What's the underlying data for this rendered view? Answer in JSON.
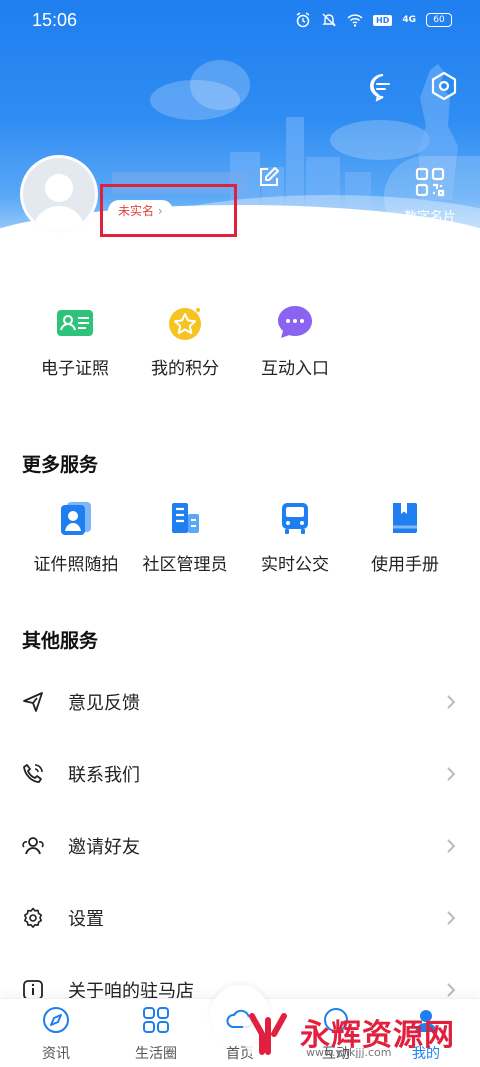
{
  "status_bar": {
    "time": "15:06",
    "network": "4G",
    "battery": "60"
  },
  "profile": {
    "realname_badge": "未实名",
    "card_label": "数字名片"
  },
  "quick_entries": [
    {
      "label": "电子证照",
      "icon": "id-card-icon"
    },
    {
      "label": "我的积分",
      "icon": "points-star-icon"
    },
    {
      "label": "互动入口",
      "icon": "chat-bubble-icon"
    }
  ],
  "more_services": {
    "title": "更多服务",
    "items": [
      {
        "label": "证件照随拍",
        "icon": "id-photo-icon"
      },
      {
        "label": "社区管理员",
        "icon": "community-building-icon"
      },
      {
        "label": "实时公交",
        "icon": "bus-icon"
      },
      {
        "label": "使用手册",
        "icon": "manual-book-icon"
      }
    ]
  },
  "other_services": {
    "title": "其他服务",
    "items": [
      {
        "label": "意见反馈",
        "icon": "send-icon"
      },
      {
        "label": "联系我们",
        "icon": "phone-icon"
      },
      {
        "label": "邀请好友",
        "icon": "users-icon"
      },
      {
        "label": "设置",
        "icon": "gear-icon"
      },
      {
        "label": "关于咱的驻马店",
        "icon": "info-icon"
      }
    ]
  },
  "bottom_nav": [
    {
      "label": "资讯",
      "icon": "compass-icon"
    },
    {
      "label": "生活圈",
      "icon": "grid-apps-icon"
    },
    {
      "label": "首页",
      "icon": "home-cloud-icon"
    },
    {
      "label": "互动",
      "icon": "interact-icon"
    },
    {
      "label": "我的",
      "icon": "me-icon"
    }
  ],
  "watermark": {
    "text": "永辉资源网",
    "url": "www.yhkjjj.com"
  },
  "colors": {
    "primary": "#1f7ff0",
    "highlight_border": "#e0203c",
    "badge_text": "#e0443e"
  }
}
